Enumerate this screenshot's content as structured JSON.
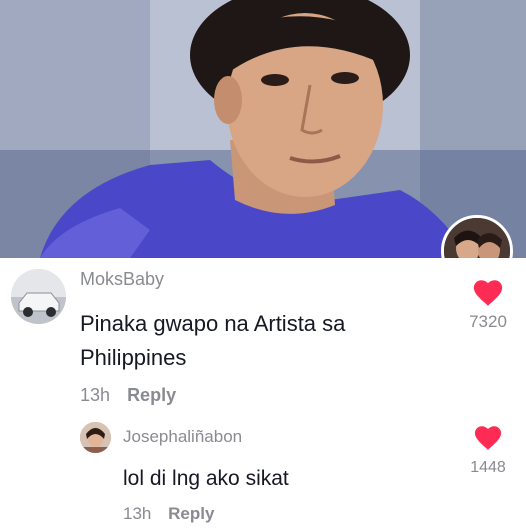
{
  "comments": [
    {
      "username": "MoksBaby",
      "text_line1": "Pinaka gwapo na Artista sa",
      "text_line2": "Philippines",
      "time": "13h",
      "reply_label": "Reply",
      "likes": "7320"
    },
    {
      "username": "Josephaliñabon",
      "text": "lol di lng ako sikat",
      "time": "13h",
      "reply_label": "Reply",
      "likes": "1448"
    }
  ],
  "colors": {
    "heart": "#fe2c55",
    "username": "#8a8b91",
    "text": "#161823"
  },
  "icons": {
    "like": "heart-icon",
    "disc": "music-disc-icon"
  }
}
